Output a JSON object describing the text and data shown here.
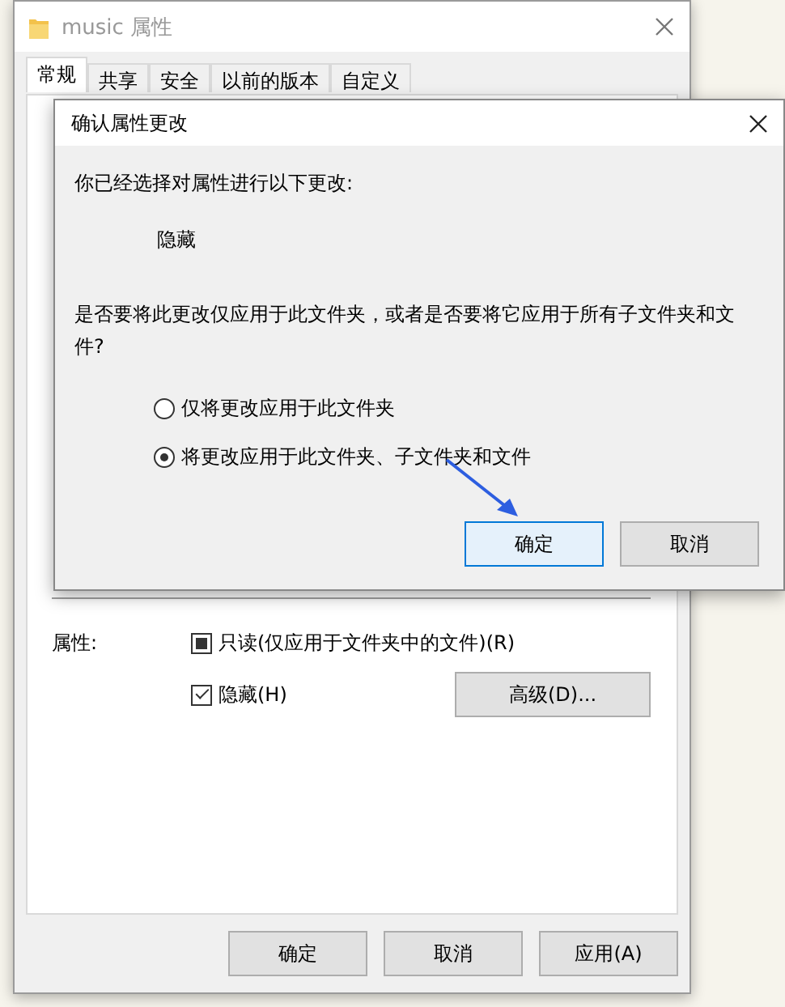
{
  "window": {
    "title": "music 属性"
  },
  "tabs": [
    {
      "label": "常规",
      "selected": true
    },
    {
      "label": "共享",
      "selected": false
    },
    {
      "label": "安全",
      "selected": false
    },
    {
      "label": "以前的版本",
      "selected": false
    },
    {
      "label": "自定义",
      "selected": false
    }
  ],
  "attributes": {
    "label": "属性:",
    "options": [
      {
        "label": "只读(仅应用于文件夹中的文件)(R)",
        "kind": "tristate",
        "checked": true
      },
      {
        "label": "隐藏(H)",
        "kind": "checkbox",
        "checked": true
      }
    ],
    "advanced_button": "高级(D)..."
  },
  "buttons": [
    "确定",
    "取消",
    "应用(A)"
  ],
  "dialog": {
    "title": "确认属性更改",
    "intro": "你已经选择对属性进行以下更改:",
    "change": "隐藏",
    "question": "是否要将此更改仅应用于此文件夹，或者是否要将它应用于所有子文件夹和文件?",
    "options": [
      {
        "label": "仅将更改应用于此文件夹",
        "selected": false
      },
      {
        "label": "将更改应用于此文件夹、子文件夹和文件",
        "selected": true
      }
    ],
    "buttons": [
      {
        "label": "确定",
        "default": true
      },
      {
        "label": "取消",
        "default": false
      }
    ]
  }
}
